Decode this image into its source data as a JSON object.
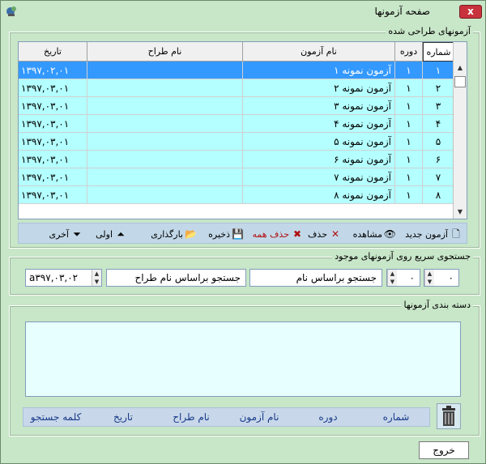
{
  "window": {
    "title": "صفحه آزمونها",
    "close_label": "x"
  },
  "exams_group": {
    "label": "آزمونهای طراحی شده",
    "columns": [
      "شماره",
      "دوره",
      "نام آزمون",
      "نام طراح",
      "تاریخ"
    ],
    "rows": [
      {
        "num": "۱",
        "period": "۱",
        "name": "آزمون نمونه ۱",
        "designer": "",
        "date": "۱۳۹۷,۰۲,۰۱"
      },
      {
        "num": "۲",
        "period": "۱",
        "name": "آزمون نمونه ۲",
        "designer": "",
        "date": "۱۳۹۷,۰۳,۰۱"
      },
      {
        "num": "۳",
        "period": "۱",
        "name": "آزمون نمونه ۳",
        "designer": "",
        "date": "۱۳۹۷,۰۳,۰۱"
      },
      {
        "num": "۴",
        "period": "۱",
        "name": "آزمون نمونه ۴",
        "designer": "",
        "date": "۱۳۹۷,۰۳,۰۱"
      },
      {
        "num": "۵",
        "period": "۱",
        "name": "آزمون نمونه ۵",
        "designer": "",
        "date": "۱۳۹۷,۰۳,۰۱"
      },
      {
        "num": "۶",
        "period": "۱",
        "name": "آزمون نمونه ۶",
        "designer": "",
        "date": "۱۳۹۷,۰۳,۰۱"
      },
      {
        "num": "۷",
        "period": "۱",
        "name": "آزمون نمونه ۷",
        "designer": "",
        "date": "۱۳۹۷,۰۳,۰۱"
      },
      {
        "num": "۸",
        "period": "۱",
        "name": "آزمون نمونه ۸",
        "designer": "",
        "date": "۱۳۹۷,۰۳,۰۱"
      }
    ]
  },
  "toolbar": {
    "new_label": "آزمون جدید",
    "view_label": "مشاهده",
    "delete_label": "حذف",
    "delete_all_label": "حذف همه",
    "save_label": "ذخیره",
    "load_label": "بارگذاری",
    "first_label": "اولی",
    "last_label": "آخری"
  },
  "quick_search": {
    "label": "جستجوی سریع روی آزمونهای موجود",
    "num_value": "۰",
    "period_value": "۰",
    "name_value": "جستجو براساس نام",
    "designer_value": "جستجو براساس نام طراح",
    "date_value": "a۳۹۷,۰۳,۰۲"
  },
  "categories": {
    "label": "دسته بندی آزمونها",
    "items": [
      "شماره",
      "دوره",
      "نام آزمون",
      "نام طراح",
      "تاریخ",
      "کلمه جستجو"
    ]
  },
  "exit_label": "خروج"
}
